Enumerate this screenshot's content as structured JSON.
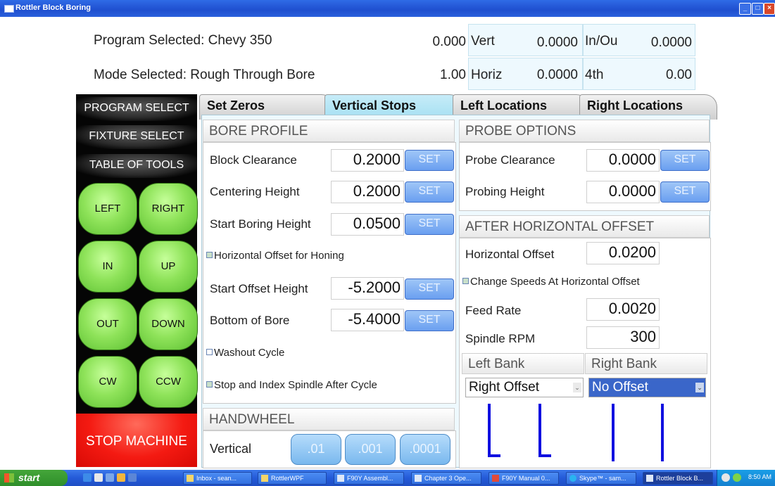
{
  "window": {
    "title": "Rottler Block Boring"
  },
  "status": {
    "program_label": "Program Selected: Chevy 350",
    "mode_label": "Mode Selected: Rough Through Bore",
    "value1": "0.000",
    "value2": "1.00",
    "axes": [
      {
        "label": "Vert",
        "value": "0.0000"
      },
      {
        "label": "In/Ou",
        "value": "0.0000"
      },
      {
        "label": "Horiz",
        "value": "0.0000"
      },
      {
        "label": "4th",
        "value": "0.00"
      }
    ]
  },
  "sidebar": {
    "program_select": "PROGRAM SELECT",
    "fixture_select": "FIXTURE SELECT",
    "table_of_tools": "TABLE OF TOOLS",
    "jog": [
      "LEFT",
      "RIGHT",
      "IN",
      "UP",
      "OUT",
      "DOWN",
      "CW",
      "CCW"
    ],
    "stop": "STOP MACHINE"
  },
  "tabs": [
    "Set Zeros",
    "Vertical Stops",
    "Left Locations",
    "Right Locations"
  ],
  "active_tab": "Vertical Stops",
  "bore_profile": {
    "title": "BORE PROFILE",
    "rows": [
      {
        "label": "Block Clearance",
        "value": "0.2000",
        "button": "SET"
      },
      {
        "label": "Centering Height",
        "value": "0.2000",
        "button": "SET"
      },
      {
        "label": "Start Boring Height",
        "value": "0.0500",
        "button": "SET"
      },
      {
        "label": "Start Offset Height",
        "value": "-5.2000",
        "button": "SET"
      },
      {
        "label": "Bottom of Bore",
        "value": "-5.4000",
        "button": "SET"
      }
    ],
    "horizontal_offset_honing": "Horizontal Offset for Honing",
    "washout_cycle": "Washout Cycle",
    "stop_index": "Stop and Index Spindle After Cycle"
  },
  "handwheel": {
    "title": "HANDWHEEL",
    "label": "Vertical",
    "steps": [
      ".01",
      ".001",
      ".0001"
    ]
  },
  "probe_options": {
    "title": "PROBE OPTIONS",
    "rows": [
      {
        "label": "Probe Clearance",
        "value": "0.0000",
        "button": "SET"
      },
      {
        "label": "Probing Height",
        "value": "0.0000",
        "button": "SET"
      }
    ]
  },
  "after_offset": {
    "title": "AFTER HORIZONTAL OFFSET",
    "horizontal_offset_label": "Horizontal Offset",
    "horizontal_offset_value": "0.0200",
    "change_speeds": "Change Speeds At Horizontal Offset",
    "feed_rate_label": "Feed Rate",
    "feed_rate_value": "0.0020",
    "spindle_rpm_label": "Spindle RPM",
    "spindle_rpm_value": "300"
  },
  "banks": {
    "left_title": "Left Bank",
    "right_title": "Right Bank",
    "left_select": "Right Offset",
    "right_select": "No Offset"
  },
  "taskbar": {
    "start": "start",
    "tasks": [
      "Inbox - sean...",
      "RottlerWPF",
      "F90Y Assembl...",
      "Chapter 3 Ope...",
      "F90Y Manual 0...",
      "Skype™ - sam...",
      "Rottler Block B..."
    ],
    "clock": "8:50 AM"
  },
  "colors": {
    "accent": "#a4dff2",
    "panel": "#eef9fe",
    "stop": "#f41a12",
    "jog": "#8fe35a",
    "tool_line": "#1010e0"
  }
}
